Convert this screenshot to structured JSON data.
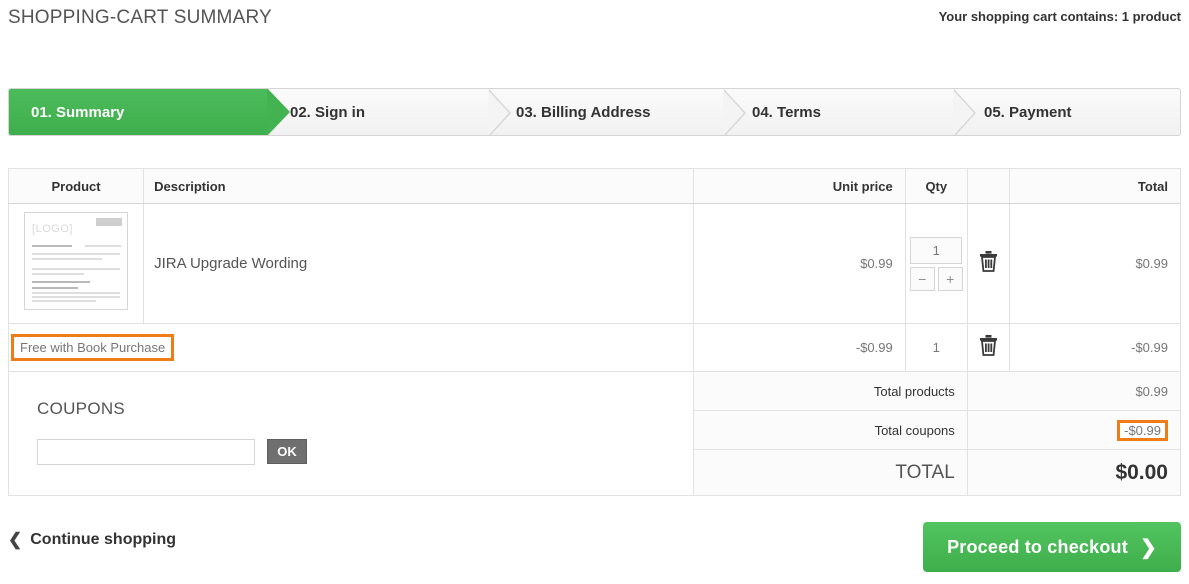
{
  "header": {
    "title": "SHOPPING-CART SUMMARY",
    "cart_summary": "Your shopping cart contains: 1 product"
  },
  "steps": [
    {
      "label": "01. Summary",
      "state": "active"
    },
    {
      "label": "02. Sign in",
      "state": "upcoming"
    },
    {
      "label": "03. Billing Address",
      "state": "upcoming"
    },
    {
      "label": "04. Terms",
      "state": "upcoming"
    },
    {
      "label": "05. Payment",
      "state": "upcoming"
    }
  ],
  "table": {
    "columns": {
      "product": "Product",
      "description": "Description",
      "unit_price": "Unit price",
      "qty": "Qty",
      "delete": "",
      "total": "Total"
    },
    "product_row": {
      "thumb_logo": "[LOGO]",
      "description": "JIRA Upgrade Wording",
      "unit_price": "$0.99",
      "qty_value": "1",
      "qty_decrease": "−",
      "qty_increase": "+",
      "delete_icon": "trash-icon",
      "total": "$0.99"
    },
    "coupon_row": {
      "name": "Free with Book Purchase",
      "unit_price": "-$0.99",
      "qty": "1",
      "delete_icon": "trash-icon",
      "total": "-$0.99"
    }
  },
  "coupons": {
    "title": "COUPONS",
    "input_value": "",
    "input_placeholder": "",
    "ok_label": "OK"
  },
  "totals": [
    {
      "label": "Total products",
      "value": "$0.99",
      "highlight": false
    },
    {
      "label": "Total coupons",
      "value": "-$0.99",
      "highlight": true
    },
    {
      "label": "TOTAL",
      "value": "$0.00",
      "highlight": false
    }
  ],
  "footer": {
    "continue_label": "Continue shopping",
    "continue_icon": "chevron-left-icon",
    "checkout_label": "Proceed to checkout",
    "checkout_icon": "chevron-right-icon"
  },
  "colors": {
    "accent_green": "#3fae4c",
    "highlight_orange": "#f07c18",
    "text": "#555454",
    "border": "#d6d4d4"
  }
}
